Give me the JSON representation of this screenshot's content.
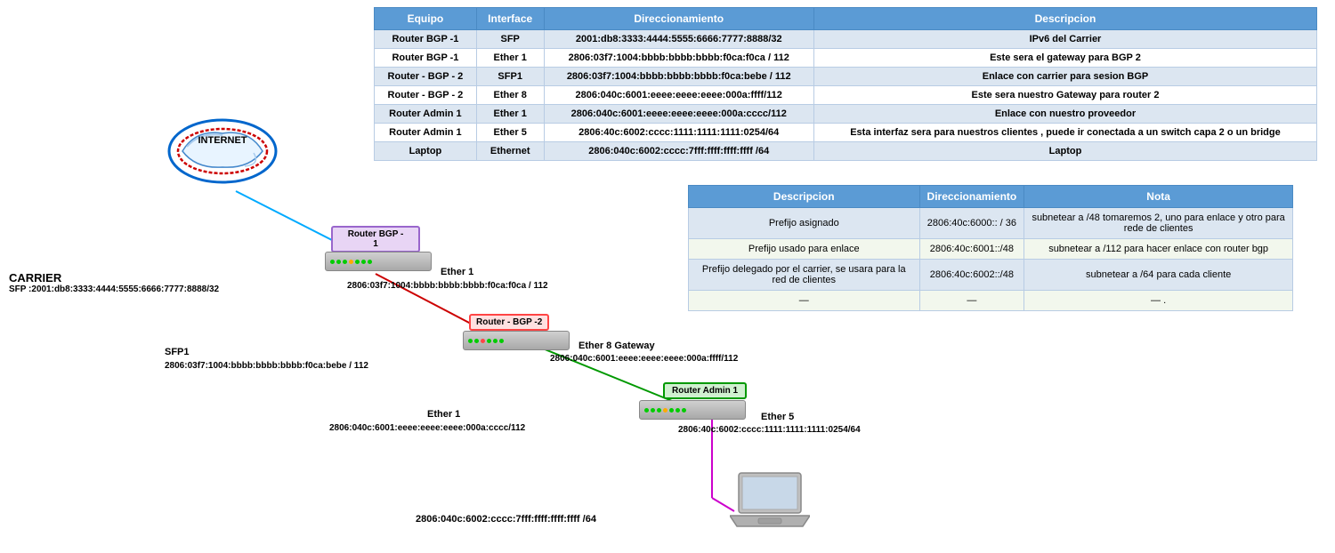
{
  "table": {
    "headers": [
      "Equipo",
      "Interface",
      "Direccionamiento",
      "Descripcion"
    ],
    "rows": [
      {
        "equipo": "Router BGP -1",
        "interface": "SFP",
        "direccionamiento": "2001:db8:3333:4444:5555:6666:7777:8888/32",
        "descripcion": "IPv6 del Carrier"
      },
      {
        "equipo": "Router BGP -1",
        "interface": "Ether 1",
        "direccionamiento": "2806:03f7:1004:bbbb:bbbb:bbbb:f0ca:f0ca / 112",
        "descripcion": "Este sera el gateway para BGP 2"
      },
      {
        "equipo": "Router - BGP - 2",
        "interface": "SFP1",
        "direccionamiento": "2806:03f7:1004:bbbb:bbbb:bbbb:f0ca:bebe / 112",
        "descripcion": "Enlace con carrier para sesion BGP"
      },
      {
        "equipo": "Router - BGP - 2",
        "interface": "Ether 8",
        "direccionamiento": "2806:040c:6001:eeee:eeee:eeee:000a:ffff/112",
        "descripcion": "Este sera nuestro Gateway para router 2"
      },
      {
        "equipo": "Router Admin 1",
        "interface": "Ether 1",
        "direccionamiento": "2806:040c:6001:eeee:eeee:eeee:000a:cccc/112",
        "descripcion": "Enlace con nuestro proveedor"
      },
      {
        "equipo": "Router Admin 1",
        "interface": "Ether 5",
        "direccionamiento": "2806:40c:6002:cccc:1111:1111:1111:0254/64",
        "descripcion": "Esta interfaz sera para nuestros clientes , puede ir conectada a un switch capa 2 o un bridge"
      },
      {
        "equipo": "Laptop",
        "interface": "Ethernet",
        "direccionamiento": "2806:040c:6002:cccc:7fff:ffff:ffff:ffff /64",
        "descripcion": "Laptop"
      }
    ]
  },
  "second_table": {
    "headers": [
      "Descripcion",
      "Direccionamiento",
      "Nota"
    ],
    "rows": [
      {
        "descripcion": "Prefijo asignado",
        "direccionamiento": "2806:40c:6000:: / 36",
        "nota": "subnetear a /48  tomaremos 2, uno para enlace y otro para rede de clientes"
      },
      {
        "descripcion": "Prefijo usado para enlace",
        "direccionamiento": "2806:40c:6001::/48",
        "nota": "subnetear a /112 para hacer enlace con router bgp"
      },
      {
        "descripcion": "Prefijo delegado por el carrier, se usara para la red de clientes",
        "direccionamiento": "2806:40c:6002::/48",
        "nota": "subnetear a /64 para cada cliente"
      },
      {
        "descripcion": "—",
        "direccionamiento": "—",
        "nota": "—  ."
      }
    ]
  },
  "diagram": {
    "internet_label": "INTERNET",
    "carrier_label": "CARRIER",
    "carrier_sfp": "SFP :2001:db8:3333:4444:5555:6666:7777:8888/32",
    "router_bgp1_label": "Router BGP -\n1",
    "router_bgp1_ether1": "Ether 1",
    "router_bgp1_addr1": "2806:03f7:1004:bbbb:bbbb:bbbb:f0ca:f0ca / 112",
    "router_bgp2_label": "Router - BGP -2",
    "router_bgp2_sfp1": "SFP1",
    "router_bgp2_addr1": "2806:03f7:1004:bbbb:bbbb:bbbb:f0ca:bebe / 112",
    "router_bgp2_ether8": "Ether 8 Gateway",
    "router_bgp2_addr2": "2806:040c:6001:eeee:eeee:eeee:000a:ffff/112",
    "router_admin1_label": "Router Admin 1",
    "router_admin1_ether1": "Ether 1",
    "router_admin1_addr1": "2806:040c:6001:eeee:eeee:eeee:000a:cccc/112",
    "router_admin1_ether5": "Ether 5",
    "router_admin1_addr2": "2806:40c:6002:cccc:1111:1111:1111:0254/64",
    "laptop_addr": "2806:040c:6002:cccc:7fff:ffff:ffff:ffff /64"
  }
}
